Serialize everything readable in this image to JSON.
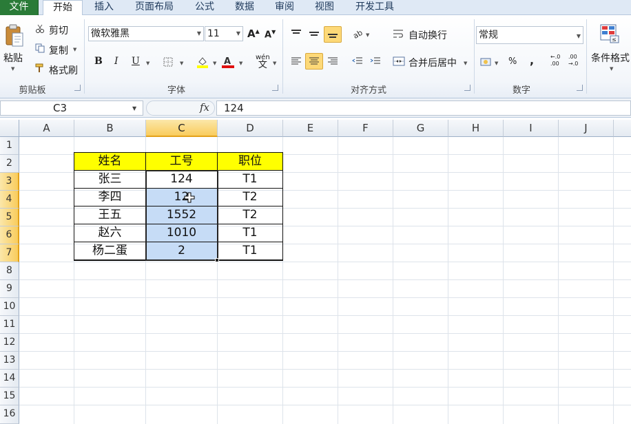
{
  "tabs": [
    "文件",
    "开始",
    "插入",
    "页面布局",
    "公式",
    "数据",
    "审阅",
    "视图",
    "开发工具"
  ],
  "clipboard": {
    "paste": "粘贴",
    "cut": "剪切",
    "copy": "复制",
    "format_painter": "格式刷",
    "label": "剪贴板"
  },
  "font": {
    "name": "微软雅黑",
    "size": "11",
    "label": "字体",
    "bold": "B",
    "italic": "I",
    "underline": "U",
    "grow": "A",
    "shrink": "A",
    "phonetic": "wén",
    "font_color_letter": "A"
  },
  "alignment": {
    "wrap_text": "自动换行",
    "merge_center": "合并后居中",
    "label": "对齐方式"
  },
  "number": {
    "format": "常规",
    "label": "数字",
    "percent": "%",
    "comma": ",",
    "inc_decimal": "←.0 .00",
    "dec_decimal": ".00 →.0"
  },
  "styles": {
    "conditional": "条件格式"
  },
  "formula_bar": {
    "name_box": "C3",
    "fx": "fx",
    "value": "124"
  },
  "colors": {
    "file_tab": "#2a7b38",
    "header_fill": "#ffff00",
    "selection_fill": "#c6dcf6",
    "active_header": "#f9cc5d"
  },
  "sheet": {
    "columns": [
      "A",
      "B",
      "C",
      "D",
      "E",
      "F",
      "G",
      "H",
      "I",
      "J"
    ],
    "rows": [
      "1",
      "2",
      "3",
      "4",
      "5",
      "6",
      "7",
      "8",
      "9",
      "10",
      "11",
      "12",
      "13",
      "14",
      "15",
      "16"
    ],
    "table": {
      "headers": [
        "姓名",
        "工号",
        "职位"
      ],
      "rows": [
        [
          "张三",
          "124",
          "T1"
        ],
        [
          "李四",
          "12",
          "T2"
        ],
        [
          "王五",
          "1552",
          "T2"
        ],
        [
          "赵六",
          "1010",
          "T1"
        ],
        [
          "杨二蛋",
          "2",
          "T1"
        ]
      ]
    }
  }
}
